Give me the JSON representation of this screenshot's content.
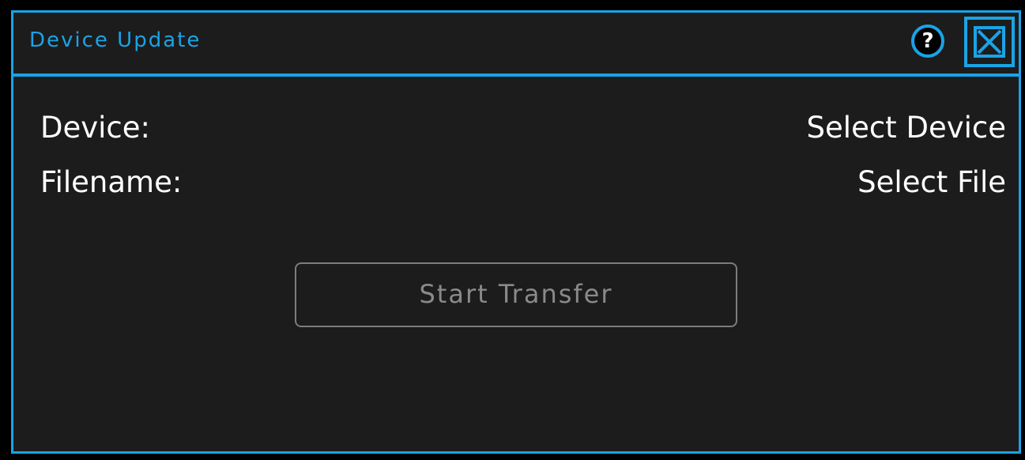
{
  "dialog": {
    "title": "Device Update",
    "help_icon": "?",
    "close_icon": "close-x-box",
    "accent_color": "#1aa3e6"
  },
  "fields": {
    "device_label": "Device:",
    "device_value": "Select Device",
    "filename_label": "Filename:",
    "filename_value": "Select File"
  },
  "actions": {
    "start_transfer_label": "Start Transfer",
    "start_transfer_enabled": false
  }
}
